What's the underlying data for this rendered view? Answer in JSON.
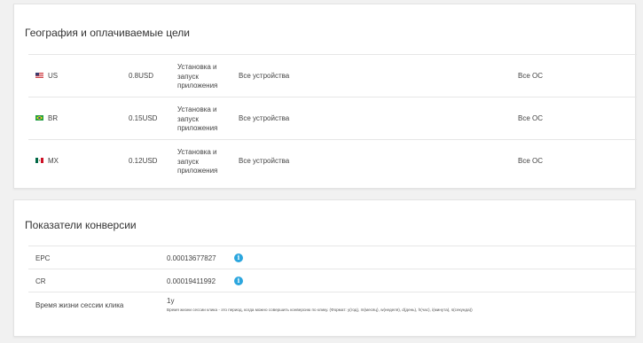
{
  "geo": {
    "title": "География и оплачиваемые цели",
    "rows": [
      {
        "country": "US",
        "price": "0.8USD",
        "action": "Установка и запуск приложения",
        "devices": "Все устройства",
        "os": "Все ОС"
      },
      {
        "country": "BR",
        "price": "0.15USD",
        "action": "Установка и запуск приложения",
        "devices": "Все устройства",
        "os": "Все ОС"
      },
      {
        "country": "MX",
        "price": "0.12USD",
        "action": "Установка и запуск приложения",
        "devices": "Все устройства",
        "os": "Все ОС"
      }
    ]
  },
  "conversion": {
    "title": "Показатели конверсии",
    "epc_label": "EPC",
    "epc_value": "0.00013677827",
    "cr_label": "CR",
    "cr_value": "0.00019411992",
    "session_label": "Время жизни сессии клика",
    "session_value": "1y",
    "session_hint": "Время жизни сессии клика - это период, когда можно совершить конверсию по клику. (Формат: y(год), m(месяц), w(неделя), d(день), h(час), i(минута), s(секунда))"
  },
  "icons": {
    "info": "info-icon",
    "accent": "#2ba6de"
  }
}
